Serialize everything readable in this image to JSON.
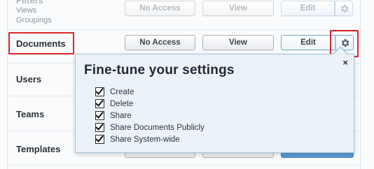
{
  "rows": [
    {
      "label": "Filters",
      "sub": [
        "Views",
        "Groupings"
      ],
      "no_access": "No Access",
      "view": "View",
      "edit": "Edit"
    },
    {
      "label": "Documents",
      "no_access": "No Access",
      "view": "View",
      "edit": "Edit"
    },
    {
      "label": "Users"
    },
    {
      "label": "Teams"
    },
    {
      "label": "Templates"
    }
  ],
  "popover": {
    "title": "Fine-tune your settings",
    "close": "×",
    "options": [
      {
        "label": "Create",
        "checked": true
      },
      {
        "label": "Delete",
        "checked": true
      },
      {
        "label": "Share",
        "checked": true
      },
      {
        "label": "Share Documents Publicly",
        "checked": true
      },
      {
        "label": "Share System-wide",
        "checked": true
      }
    ]
  },
  "colors": {
    "highlight": "#d9262d",
    "accent": "#6fa7cf",
    "popover_bg": "#ebf2fa"
  },
  "icons": {
    "gear": "gear-icon",
    "close": "close-icon",
    "check": "checkbox-checked-icon"
  }
}
